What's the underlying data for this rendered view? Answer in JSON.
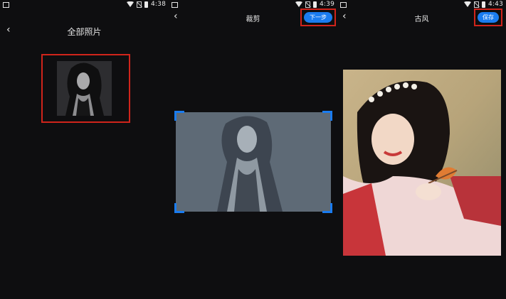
{
  "screens": [
    {
      "status": {
        "time": "4:38"
      },
      "title": "全部照片"
    },
    {
      "status": {
        "time": "4:39"
      },
      "title": "裁剪",
      "next_button": "下一步"
    },
    {
      "status": {
        "time": "4:43"
      },
      "title": "古风",
      "save_button": "保存"
    }
  ],
  "colors": {
    "accent": "#1a7cf0",
    "highlight_box": "#d0241b",
    "background": "#0e0e10"
  },
  "icons": [
    "back-arrow-icon",
    "wifi-icon",
    "no-sim-icon",
    "battery-icon"
  ]
}
